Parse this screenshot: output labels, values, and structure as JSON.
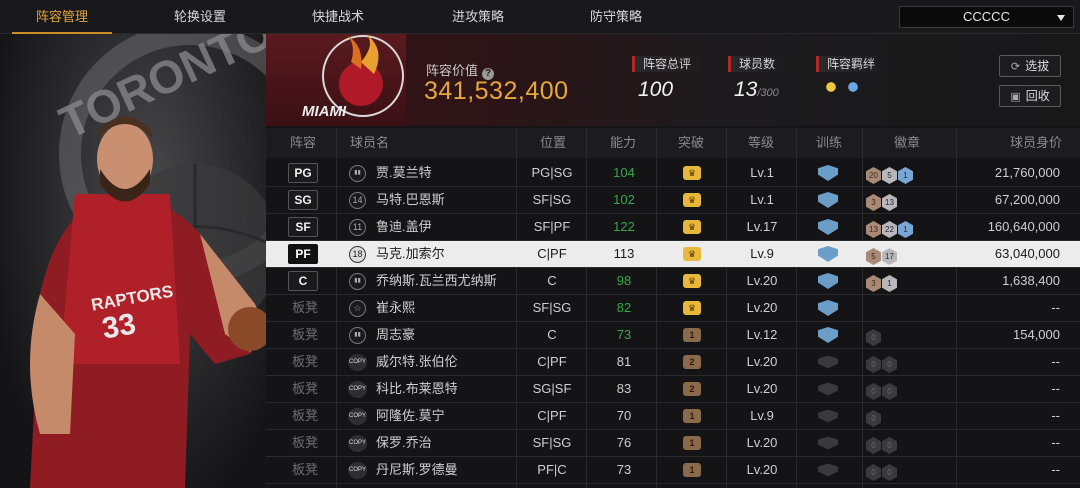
{
  "nav": {
    "tabs": [
      "阵容管理",
      "轮换设置",
      "快捷战术",
      "进攻策略",
      "防守策略"
    ],
    "active_index": 0,
    "team_select": "CCCCC"
  },
  "header": {
    "team_logo_text": "MIAMI",
    "value_label": "阵容价值",
    "value": "341,532,400",
    "overall_label": "阵容总评",
    "overall_value": "100",
    "count_label": "球员数",
    "count_value": "13",
    "count_max": "/300",
    "bond_label": "阵容羁绊",
    "select_button": "选拔",
    "recycle_button": "回收"
  },
  "table": {
    "headers": [
      "阵容",
      "球员名",
      "位置",
      "能力",
      "突破",
      "等级",
      "训练",
      "徽章",
      "球员身价"
    ],
    "rows": [
      {
        "slot": "PG",
        "jersey": "11",
        "jersey_type": "bars",
        "name": "贾.莫兰特",
        "position": "PG|SG",
        "rating": "104",
        "rating_color": "green",
        "breakthrough": "crown",
        "level": "Lv.1",
        "training": "on",
        "badges": [
          {
            "t": "bronze",
            "v": "20"
          },
          {
            "t": "silver",
            "v": "5"
          },
          {
            "t": "gold",
            "v": "1"
          }
        ],
        "value": "21,760,000"
      },
      {
        "slot": "SG",
        "jersey": "14",
        "jersey_type": "num",
        "name": "马特.巴恩斯",
        "position": "SF|SG",
        "rating": "102",
        "rating_color": "green",
        "breakthrough": "crown",
        "level": "Lv.1",
        "training": "on",
        "badges": [
          {
            "t": "bronze",
            "v": "3"
          },
          {
            "t": "silver",
            "v": "13"
          }
        ],
        "value": "67,200,000"
      },
      {
        "slot": "SF",
        "jersey": "11",
        "jersey_type": "num",
        "name": "鲁迪.盖伊",
        "position": "SF|PF",
        "rating": "122",
        "rating_color": "green",
        "breakthrough": "crown",
        "level": "Lv.17",
        "training": "on",
        "badges": [
          {
            "t": "bronze",
            "v": "13"
          },
          {
            "t": "silver",
            "v": "22"
          },
          {
            "t": "gold",
            "v": "1"
          }
        ],
        "value": "160,640,000"
      },
      {
        "slot": "PF",
        "jersey": "18",
        "jersey_type": "num",
        "name": "马克.加索尔",
        "position": "C|PF",
        "rating": "113",
        "rating_color": "normal",
        "breakthrough": "crown",
        "level": "Lv.9",
        "training": "on",
        "badges": [
          {
            "t": "bronze",
            "v": "5"
          },
          {
            "t": "silver",
            "v": "17"
          }
        ],
        "value": "63,040,000",
        "selected": true
      },
      {
        "slot": "C",
        "jersey": "11",
        "jersey_type": "bars",
        "name": "乔纳斯.瓦兰西尤纳斯",
        "position": "C",
        "rating": "98",
        "rating_color": "green",
        "breakthrough": "crown",
        "level": "Lv.20",
        "training": "on",
        "badges": [
          {
            "t": "bronze",
            "v": "3"
          },
          {
            "t": "silver",
            "v": "1"
          }
        ],
        "value": "1,638,400"
      },
      {
        "slot": "板凳",
        "jersey": "☆",
        "jersey_type": "star",
        "name": "崔永熙",
        "position": "SF|SG",
        "rating": "82",
        "rating_color": "green",
        "breakthrough": "crown",
        "level": "Lv.20",
        "training": "on",
        "badges": [],
        "value": "--"
      },
      {
        "slot": "板凳",
        "jersey": "11",
        "jersey_type": "bars",
        "name": "周志豪",
        "position": "C",
        "rating": "73",
        "rating_color": "green",
        "breakthrough": "1",
        "level": "Lv.12",
        "training": "on",
        "badges": [
          {
            "t": "empty",
            "v": "0"
          }
        ],
        "value": "154,000"
      },
      {
        "slot": "板凳",
        "jersey": "COPY",
        "jersey_type": "copy",
        "name": "威尔特.张伯伦",
        "position": "C|PF",
        "rating": "81",
        "rating_color": "normal",
        "breakthrough": "2",
        "level": "Lv.20",
        "training": "off",
        "badges": [
          {
            "t": "empty",
            "v": "0"
          },
          {
            "t": "empty",
            "v": "0"
          }
        ],
        "value": "--"
      },
      {
        "slot": "板凳",
        "jersey": "COPY",
        "jersey_type": "copy",
        "name": "科比.布莱恩特",
        "position": "SG|SF",
        "rating": "83",
        "rating_color": "normal",
        "breakthrough": "2",
        "level": "Lv.20",
        "training": "off",
        "badges": [
          {
            "t": "empty",
            "v": "0"
          },
          {
            "t": "empty",
            "v": "0"
          }
        ],
        "value": "--"
      },
      {
        "slot": "板凳",
        "jersey": "COPY",
        "jersey_type": "copy",
        "name": "阿隆佐.莫宁",
        "position": "C|PF",
        "rating": "70",
        "rating_color": "normal",
        "breakthrough": "1",
        "level": "Lv.9",
        "training": "off",
        "badges": [
          {
            "t": "empty",
            "v": "0"
          }
        ],
        "value": "--"
      },
      {
        "slot": "板凳",
        "jersey": "COPY",
        "jersey_type": "copy",
        "name": "保罗.乔治",
        "position": "SF|SG",
        "rating": "76",
        "rating_color": "normal",
        "breakthrough": "1",
        "level": "Lv.20",
        "training": "off",
        "badges": [
          {
            "t": "empty",
            "v": "0"
          },
          {
            "t": "empty",
            "v": "0"
          }
        ],
        "value": "--"
      },
      {
        "slot": "板凳",
        "jersey": "COPY",
        "jersey_type": "copy",
        "name": "丹尼斯.罗德曼",
        "position": "PF|C",
        "rating": "73",
        "rating_color": "normal",
        "breakthrough": "1",
        "level": "Lv.20",
        "training": "off",
        "badges": [
          {
            "t": "empty",
            "v": "0"
          },
          {
            "t": "empty",
            "v": "0"
          }
        ],
        "value": "--"
      }
    ]
  },
  "player_art": {
    "jersey_text": "RAPTORS",
    "jersey_number": "33",
    "team_text": "TORONTO"
  },
  "colors": {
    "accent": "#e0a43c",
    "value": "#e8a73a",
    "green": "#3aa64a",
    "selected_row": "#ececec"
  }
}
